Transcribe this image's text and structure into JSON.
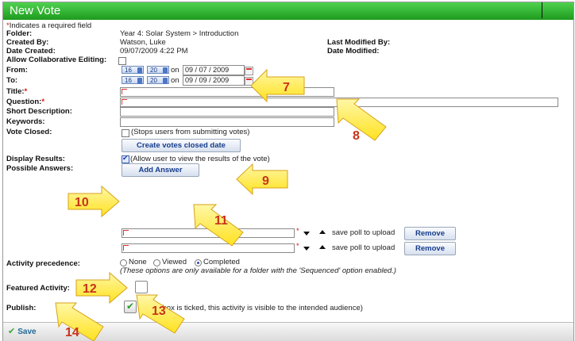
{
  "window": {
    "title": "New Vote"
  },
  "form": {
    "required_note": "Indicates a required field",
    "required_star": "*",
    "folder_label": "Folder:",
    "folder_value": "Year 4: Solar System > Introduction",
    "created_by_label": "Created By:",
    "created_by_value": "Watson, Luke",
    "last_modified_label": "Last Modified By:",
    "date_created_label": "Date Created:",
    "date_created_value": "09/07/2009 4:22 PM",
    "date_modified_label": "Date Modified:",
    "collab_label": "Allow Collaborative Editing:",
    "from_label": "From:",
    "to_label": "To:",
    "from": {
      "hour": "16",
      "minute": "20",
      "on": "on",
      "day": "09",
      "month": "07",
      "year": "2009"
    },
    "to": {
      "hour": "16",
      "minute": "20",
      "on": "on",
      "day": "09",
      "month": "09",
      "year": "2009"
    },
    "date_sep": "/",
    "title_label": "Title:",
    "question_label": "Question:",
    "short_desc_label": "Short Description:",
    "keywords_label": "Keywords:",
    "vote_closed_label": "Vote Closed:",
    "vote_closed_text": "(Stops users from submitting votes)",
    "create_closed_button": "Create votes closed date",
    "display_results_label": "Display Results:",
    "display_results_text": "(Allow user to view the results of the vote)",
    "possible_answers_label": "Possible Answers:",
    "add_answer_button": "Add Answer",
    "answers": [
      {
        "save_text": "save poll to upload",
        "remove": "Remove"
      },
      {
        "save_text": "save poll to upload",
        "remove": "Remove"
      }
    ],
    "activity_precedence_label": "Activity precedence:",
    "precedence_options": [
      "None",
      "Viewed",
      "Completed"
    ],
    "precedence_selected": "Completed",
    "precedence_note": "(These options are only available for a folder with the 'Sequenced' option enabled.)",
    "featured_label": "Featured Activity:",
    "publish_label": "Publish:",
    "publish_text": "(If this box is ticked, this activity is visible to the intended audience)",
    "save_button": "Save"
  },
  "callouts": [
    "7",
    "8",
    "9",
    "10",
    "11",
    "12",
    "13",
    "14"
  ],
  "colors": {
    "titlebar": "#2bb02b",
    "callout_fill": "#fff04a",
    "callout_text": "#c8331a",
    "link_button_text": "#153c8c"
  }
}
